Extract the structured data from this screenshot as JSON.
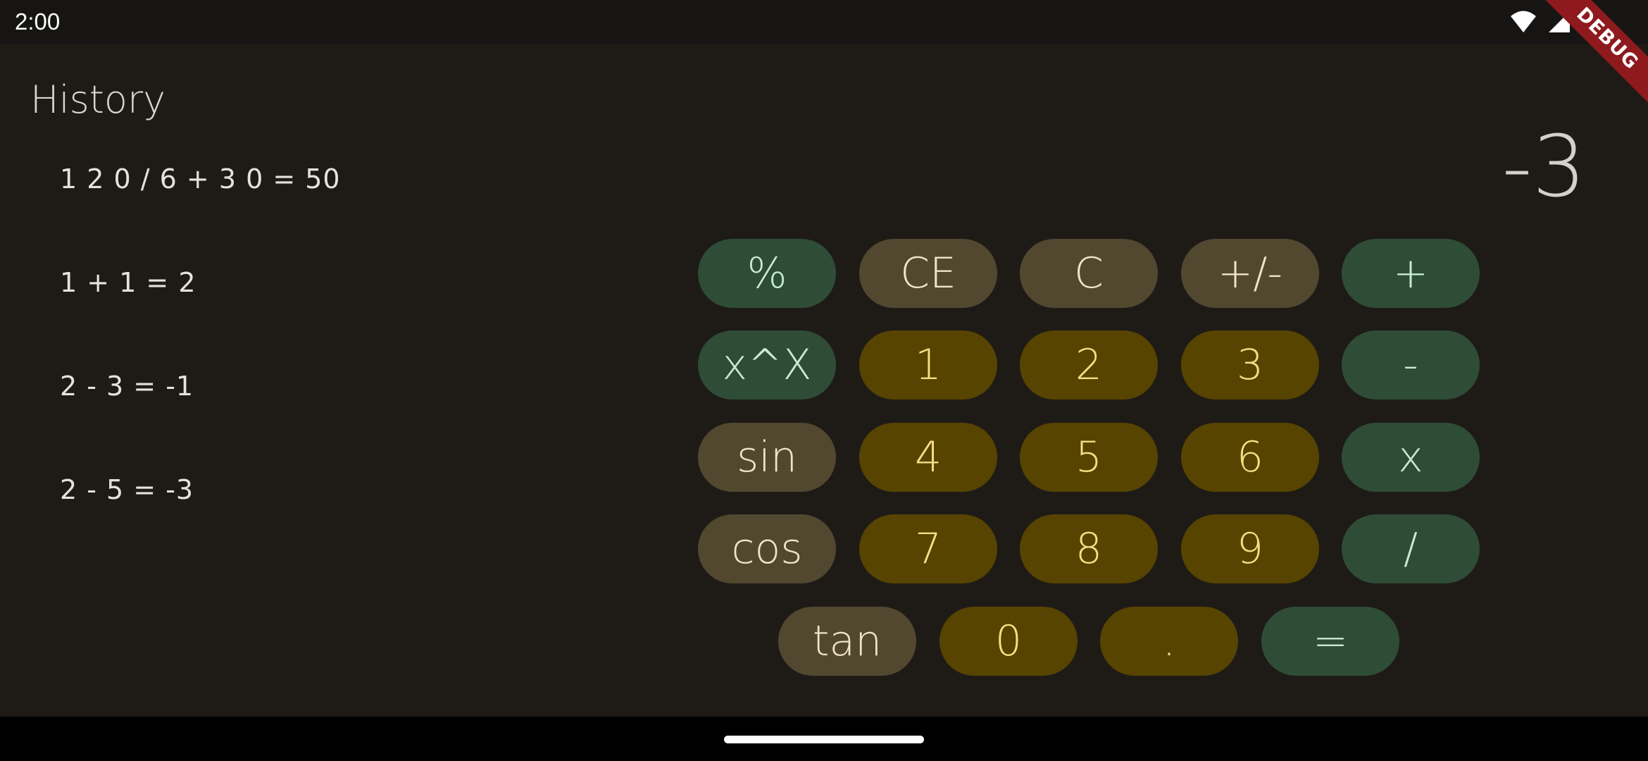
{
  "status_bar": {
    "time": "2:00",
    "icons": [
      "wifi-icon",
      "signal-icon",
      "battery-icon"
    ]
  },
  "debug_banner": "DEBUG",
  "history": {
    "title": "History",
    "items": [
      "1 2 0 / 6 + 3 0 = 50",
      "1 + 1 = 2",
      "2 - 3 = -1",
      "2 - 5 = -3"
    ]
  },
  "display": {
    "value": "-3"
  },
  "keypad": {
    "row1": [
      "%",
      "CE",
      "C",
      "+/-",
      "+"
    ],
    "row2": [
      "x^X",
      "1",
      "2",
      "3",
      "-"
    ],
    "row3": [
      "sin",
      "4",
      "5",
      "6",
      "x"
    ],
    "row4": [
      "cos",
      "7",
      "8",
      "9",
      "/"
    ],
    "row5": [
      "tan",
      "0",
      ".",
      "="
    ]
  },
  "colors": {
    "background": "#1e1b17",
    "operator_key": "#2f4c36",
    "function_key": "#524830",
    "number_key": "#574400",
    "debug_banner": "#8e1a1e"
  }
}
